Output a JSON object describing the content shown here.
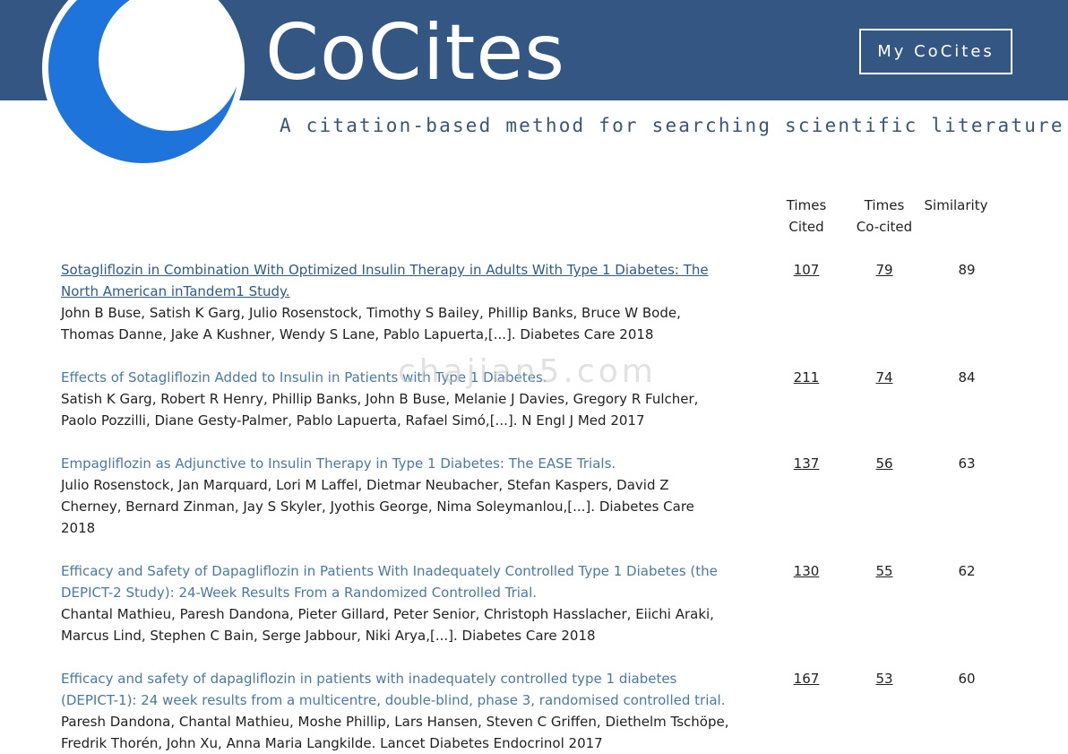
{
  "header": {
    "brand": "CoCites",
    "tagline": "A citation-based method for searching scientific literature",
    "my_button": "My CoCites",
    "logo_icon": "crescent-logo-icon"
  },
  "columns": {
    "times_cited": [
      "Times",
      "Cited"
    ],
    "times_cocited": [
      "Times",
      "Co-cited"
    ],
    "similarity": "Similarity"
  },
  "results": [
    {
      "title_line1": "Sotagliflozin in Combination With Optimized Insulin Therapy in Adults With Type 1 Diabetes: The",
      "title_line2": "North American inTandem1 Study.",
      "authors_line1": "John B Buse, Satish K Garg, Julio Rosenstock, Timothy S Bailey, Phillip Banks, Bruce W Bode,",
      "authors_line2": "Thomas Danne, Jake A Kushner, Wendy S Lane, Pablo Lapuerta,[...]. Diabetes Care 2018",
      "times_cited": "107",
      "times_cocited": "79",
      "similarity": "89"
    },
    {
      "title_line1": "Effects of Sotagliflozin Added to Insulin in Patients with Type 1 Diabetes.",
      "authors_line1": "Satish K Garg, Robert R Henry, Phillip Banks, John B Buse, Melanie J Davies, Gregory R Fulcher,",
      "authors_line2": "Paolo Pozzilli, Diane Gesty-Palmer, Pablo Lapuerta, Rafael Simó,[...]. N Engl J Med 2017",
      "times_cited": "211",
      "times_cocited": "74",
      "similarity": "84"
    },
    {
      "title_line1": "Empagliflozin as Adjunctive to Insulin Therapy in Type 1 Diabetes: The EASE Trials.",
      "authors_line1": "Julio Rosenstock, Jan Marquard, Lori M Laffel, Dietmar Neubacher, Stefan Kaspers, David Z",
      "authors_line2": "Cherney, Bernard Zinman, Jay S Skyler, Jyothis George, Nima Soleymanlou,[...]. Diabetes Care",
      "authors_line3": "2018",
      "times_cited": "137",
      "times_cocited": "56",
      "similarity": "63"
    },
    {
      "title_line1": "Efficacy and Safety of Dapagliflozin in Patients With Inadequately Controlled Type 1 Diabetes (the",
      "title_line2": "DEPICT-2 Study): 24-Week Results From a Randomized Controlled Trial.",
      "authors_line1": "Chantal Mathieu, Paresh Dandona, Pieter Gillard, Peter Senior, Christoph Hasslacher, Eiichi Araki,",
      "authors_line2": "Marcus Lind, Stephen C Bain, Serge Jabbour, Niki Arya,[...]. Diabetes Care 2018",
      "times_cited": "130",
      "times_cocited": "55",
      "similarity": "62"
    },
    {
      "title_line1": "Efficacy and safety of dapagliflozin in patients with inadequately controlled type 1 diabetes",
      "title_line2": "(DEPICT-1): 24 week results from a multicentre, double-blind, phase 3, randomised controlled trial.",
      "authors_line1": "Paresh Dandona, Chantal Mathieu, Moshe Phillip, Lars Hansen, Steven C Griffen, Diethelm Tschöpe,",
      "authors_line2": "Fredrik Thorén, John Xu, Anna Maria Langkilde. Lancet Diabetes Endocrinol 2017",
      "times_cited": "167",
      "times_cocited": "53",
      "similarity": "60"
    }
  ],
  "watermark": "chajian5.com",
  "colors": {
    "banner": "#335682",
    "logo_blue": "#1f74dc",
    "link": "#4a79a5",
    "visited_link": "#2f5b86"
  }
}
